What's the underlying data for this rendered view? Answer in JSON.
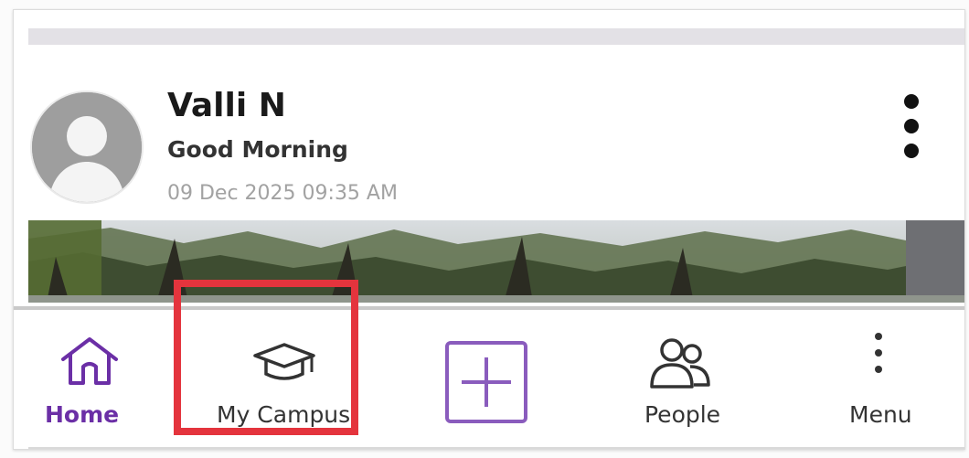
{
  "profile": {
    "name": "Valli N",
    "greeting": "Good Morning",
    "timestamp": "09 Dec 2025 09:35 AM",
    "avatar_icon": "default-user-avatar-icon",
    "menu_icon": "more-vertical-icon"
  },
  "nav": {
    "items": [
      {
        "label": "Home",
        "icon": "home-icon",
        "active": true
      },
      {
        "label": "My Campus",
        "icon": "graduation-cap-icon",
        "active": false
      },
      {
        "label": "",
        "icon": "add-square-icon",
        "active": false
      },
      {
        "label": "People",
        "icon": "people-icon",
        "active": false
      },
      {
        "label": "Menu",
        "icon": "more-vertical-icon",
        "active": false
      }
    ]
  },
  "colors": {
    "accent": "#6b2fa6",
    "highlight": "#e4343d"
  }
}
